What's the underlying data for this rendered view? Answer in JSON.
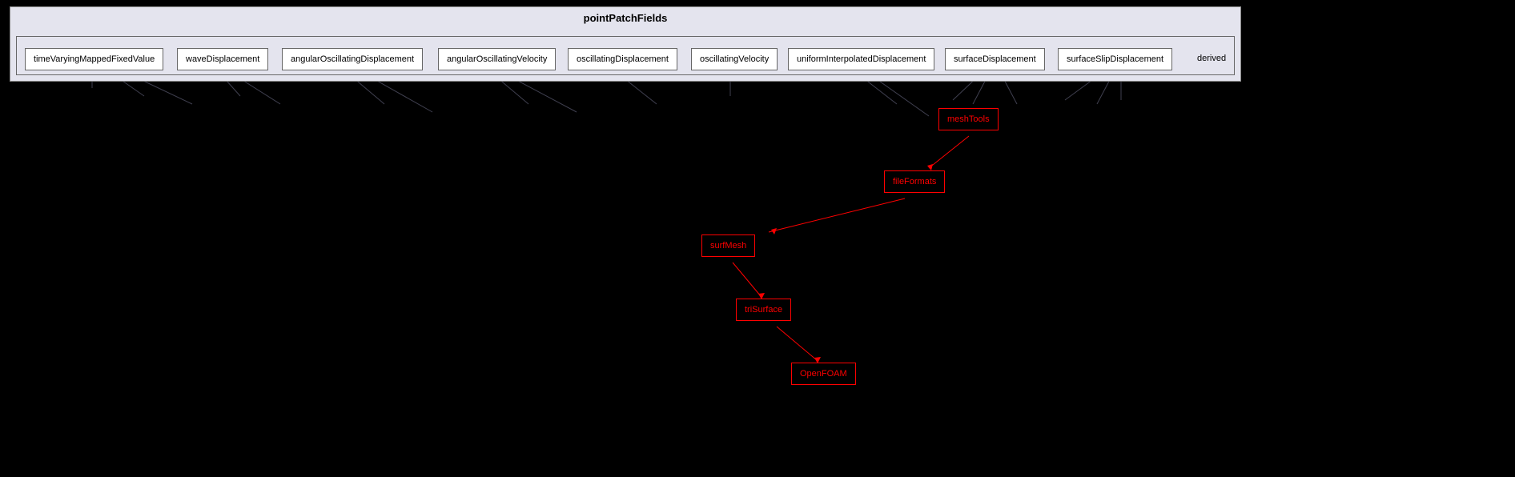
{
  "main": {
    "title": "pointPatchFields"
  },
  "nodes": {
    "timeVaryingMappedFixedValue": "timeVaryingMappedFixedValue",
    "waveDisplacement": "waveDisplacement",
    "angularOscillatingDisplacement": "angularOscillatingDisplacement",
    "angularOscillatingVelocity": "angularOscillatingVelocity",
    "oscillatingDisplacement": "oscillatingDisplacement",
    "oscillatingVelocity": "oscillatingVelocity",
    "uniformInterpolatedDisplacement": "uniformInterpolatedDisplacement",
    "surfaceDisplacement": "surfaceDisplacement",
    "surfaceSlipDisplacement": "surfaceSlipDisplacement",
    "derived": "derived"
  },
  "red_nodes": {
    "meshTools": "meshTools",
    "fileFormats": "fileFormats",
    "surfMesh": "surfMesh",
    "triSurface": "triSurface",
    "OpenFOAM": "OpenFOAM"
  }
}
